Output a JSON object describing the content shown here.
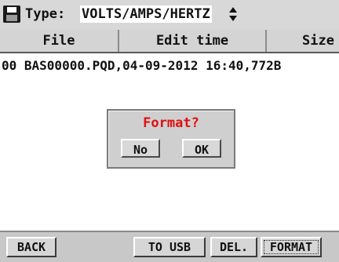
{
  "type_bar": {
    "label": "Type:",
    "value": "VOLTS/AMPS/HERTZ"
  },
  "columns": [
    "File",
    "Edit time",
    "Size"
  ],
  "files": [
    {
      "text": "00 BAS00000.PQD,04-09-2012 16:40,772B"
    }
  ],
  "dialog": {
    "title": "Format?",
    "no_label": "No",
    "ok_label": "OK",
    "title_color": "#e01010"
  },
  "toolbar": {
    "back_label": "BACK",
    "usb_label": "TO USB",
    "del_label": "DEL.",
    "format_label": "FORMAT"
  },
  "icons": {
    "disk": "floppy-disk-icon",
    "spin": "up-down-arrows-icon"
  }
}
